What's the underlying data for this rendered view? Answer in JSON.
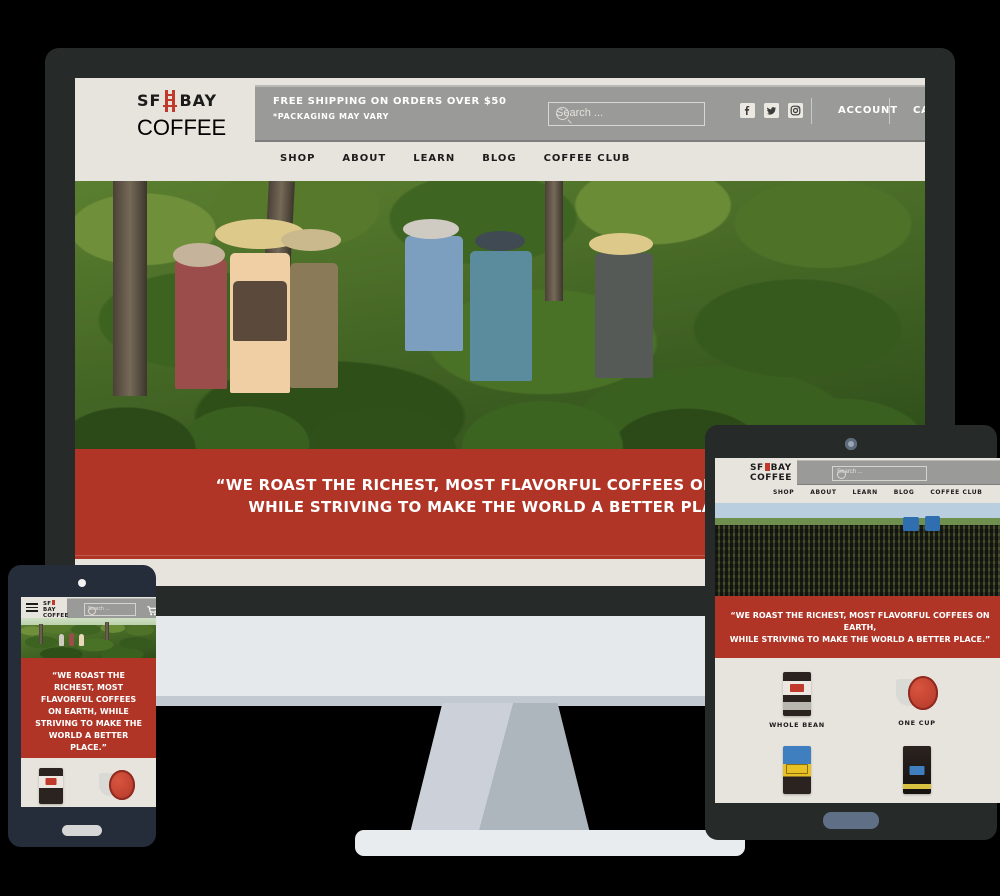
{
  "brand": {
    "name_line1": "SF",
    "name_line2": "BAY",
    "name_line3": "COFFEE",
    "accent_color": "#b03527",
    "background_color": "#e7e3dd",
    "bar_color": "#9a9a98",
    "device_frame_color": "#262b2a",
    "phone_frame_color": "#252d3a"
  },
  "desktop": {
    "promo": {
      "line1": "FREE SHIPPING ON ORDERS OVER $50",
      "line2": "*PACKAGING MAY VARY"
    },
    "search": {
      "placeholder": "Search ...",
      "value": "",
      "icon": "search-icon"
    },
    "social": [
      {
        "name": "facebook-icon",
        "label": "Facebook"
      },
      {
        "name": "twitter-icon",
        "label": "Twitter"
      },
      {
        "name": "instagram-icon",
        "label": "Instagram"
      }
    ],
    "account_label": "ACCOUNT",
    "cart_label": "CART",
    "cart_icon": "shopping-cart-icon",
    "nav": [
      {
        "label": "SHOP"
      },
      {
        "label": "ABOUT"
      },
      {
        "label": "LEARN"
      },
      {
        "label": "BLOG"
      },
      {
        "label": "COFFEE CLUB"
      }
    ],
    "hero_image_alt": "Coffee farmers and visitors standing among coffee plants on a sunny hillside farm",
    "quote": {
      "line1": "“WE ROAST THE RICHEST, MOST FLAVORFUL COFFEES ON EARTH,",
      "line2": "WHILE STRIVING TO MAKE THE WORLD A BETTER PLACE.”"
    }
  },
  "tablet": {
    "search": {
      "placeholder": "Search ...",
      "value": ""
    },
    "cart_icon": "shopping-cart-icon",
    "nav": [
      {
        "label": "SHOP"
      },
      {
        "label": "ABOUT"
      },
      {
        "label": "LEARN"
      },
      {
        "label": "BLOG"
      },
      {
        "label": "COFFEE CLUB"
      }
    ],
    "hero_image_alt": "Rows of young coffee seedlings in black nursery bags at a coffee farm",
    "quote": {
      "line1": "“WE ROAST THE RICHEST, MOST FLAVORFUL COFFEES ON EARTH,",
      "line2": "WHILE STRIVING TO MAKE THE WORLD A BETTER PLACE.”"
    },
    "products": [
      {
        "label": "WHOLE BEAN",
        "icon": "coffee-bag-icon"
      },
      {
        "label": "ONE CUP",
        "icon": "k-cup-pod-icon"
      },
      {
        "label": "",
        "icon": "coffee-bag-yellow-icon"
      },
      {
        "label": "",
        "icon": "coffee-bag-dark-icon"
      }
    ]
  },
  "phone": {
    "menu_icon": "hamburger-menu-icon",
    "search": {
      "placeholder": "Search ...",
      "value": ""
    },
    "cart_icon": "shopping-cart-icon",
    "hero_image_alt": "Coffee farm hillside with workers among green coffee plants",
    "quote": {
      "line1": "“WE ROAST THE",
      "line2": "RICHEST, MOST",
      "line3": "FLAVORFUL COFFEES",
      "line4": "ON EARTH, WHILE",
      "line5": "STRIVING TO MAKE THE",
      "line6": "WORLD A BETTER",
      "line7": "PLACE.”"
    },
    "products": [
      {
        "icon": "coffee-bag-icon"
      },
      {
        "icon": "k-cup-pod-icon"
      }
    ]
  }
}
